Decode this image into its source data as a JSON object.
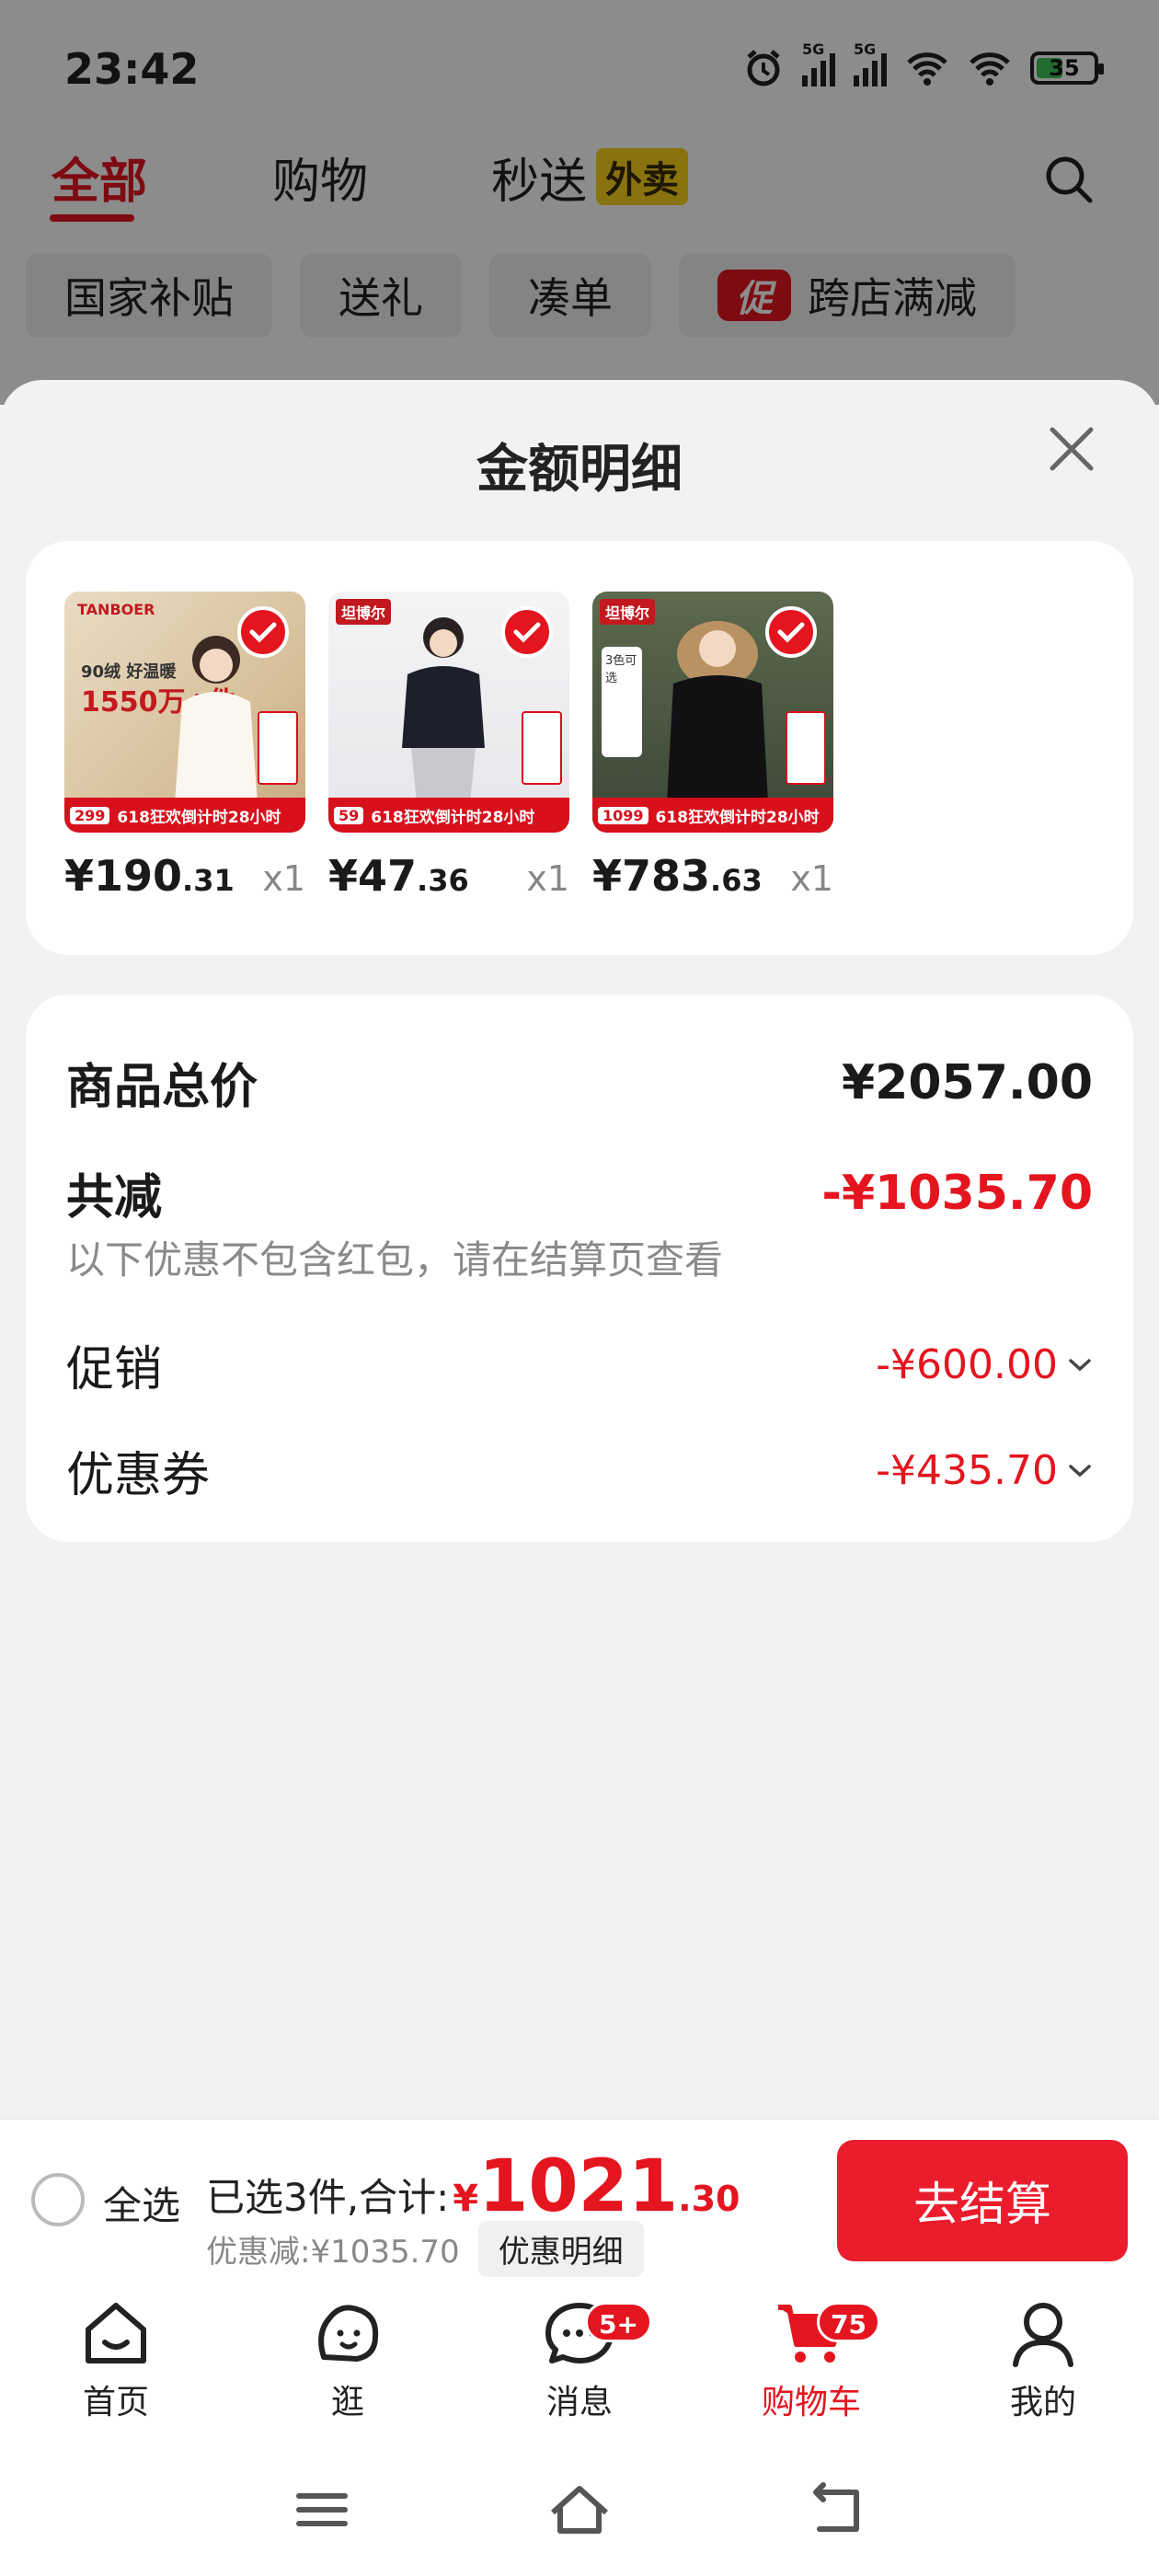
{
  "status_bar": {
    "time": "23:42",
    "signal1": "5G",
    "signal2": "5G",
    "battery": "35"
  },
  "top_tabs": [
    {
      "label": "全部"
    },
    {
      "label": "购物"
    },
    {
      "label": "秒送"
    }
  ],
  "top_tab_badge": "外卖",
  "chips": [
    {
      "label": "国家补贴"
    },
    {
      "label": "送礼"
    },
    {
      "label": "凑单"
    },
    {
      "label": "跨店满减",
      "promo": "促"
    }
  ],
  "sheet": {
    "title": "金额明细",
    "products": [
      {
        "price_int": "¥190",
        "price_dec": ".31",
        "qty": "x1",
        "thumb_price": "299",
        "thumb_strip": "618狂欢倒计时28小时",
        "brand": "TANBOER",
        "overlay": "90绒 好温暖",
        "overlay_big": "1550万+件"
      },
      {
        "price_int": "¥47",
        "price_dec": ".36",
        "qty": "x1",
        "thumb_price": "59",
        "thumb_strip": "618狂欢倒计时28小时",
        "brand": "坦博尔",
        "overlay": "",
        "overlay_big": ""
      },
      {
        "price_int": "¥783",
        "price_dec": ".63",
        "qty": "x1",
        "thumb_price": "1099",
        "thumb_strip": "618狂欢倒计时28小时",
        "brand": "坦博尔",
        "overlay": "3色可选",
        "overlay_big": ""
      }
    ],
    "summary": {
      "total_label": "商品总价",
      "total_value": "¥2057.00",
      "reduce_label": "共减",
      "reduce_value": "-¥1035.70",
      "note": "以下优惠不包含红包，请在结算页查看",
      "promo_label": "促销",
      "promo_value": "-¥600.00",
      "coupon_label": "优惠券",
      "coupon_value": "-¥435.70"
    }
  },
  "action_bar": {
    "select_all": "全选",
    "selected_text": "已选3件,合计:",
    "currency": "¥",
    "total_int": "1021",
    "total_dec": ".30",
    "discount_text": "优惠减:¥1035.70",
    "detail_label": "优惠明细",
    "checkout_label": "去结算"
  },
  "bottom_nav": [
    {
      "label": "首页"
    },
    {
      "label": "逛"
    },
    {
      "label": "消息",
      "badge": "5+"
    },
    {
      "label": "购物车",
      "badge": "75"
    },
    {
      "label": "我的"
    }
  ],
  "colors": {
    "accent": "#e4151f",
    "checkout": "#eb1c2c",
    "background": "#f2f2f4"
  }
}
